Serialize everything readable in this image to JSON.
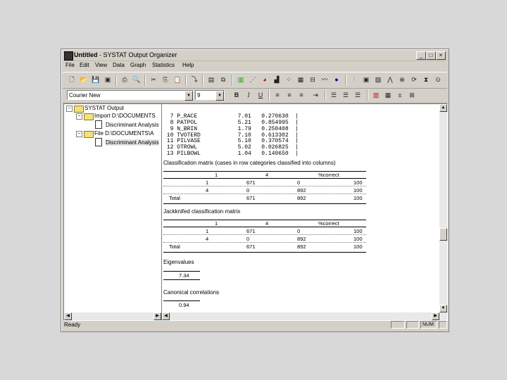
{
  "window": {
    "title_app": "Untitled",
    "title_rest": " - SYSTAT Output Organizer",
    "controls": [
      "_",
      "□",
      "×"
    ]
  },
  "menu": [
    "File",
    "Edit",
    "View",
    "Data",
    "Graph",
    "Statistics",
    "Help"
  ],
  "format_bar": {
    "font": "Courier New",
    "size": "9",
    "bold": "B",
    "italic": "I",
    "underline": "U"
  },
  "tree": {
    "root": "SYSTAT Output",
    "import_node": "Import D:\\DOCUMENTS",
    "import_child": "Discriminant Analysis",
    "file_node": "File D:\\DOCUMENTS\\A",
    "file_child": "Discriminant Analysis"
  },
  "output": {
    "var_rows": [
      {
        "n": "7",
        "name": "P_RACE",
        "f": "7.01",
        "p": "0.270630"
      },
      {
        "n": "8",
        "name": "PATPOL",
        "f": "5.21",
        "p": "0.854995"
      },
      {
        "n": "9",
        "name": "N_BRIN",
        "f": "1.79",
        "p": "0.250408"
      },
      {
        "n": "10",
        "name": "TVOTERD",
        "f": "7.10",
        "p": "0.613302"
      },
      {
        "n": "11",
        "name": "PILVASE",
        "f": "5.10",
        "p": "0.370574"
      },
      {
        "n": "12",
        "name": "OTROWL",
        "f": "5.02",
        "p": "0.026825"
      },
      {
        "n": "13",
        "name": "PILBOWL",
        "f": "1.04",
        "p": "0.140650"
      }
    ],
    "classification_title": "Classification matrix (cases in row categories classified into columns)",
    "jackknifed_title": "Jackknifed classification matrix",
    "matrix_header": [
      "1",
      "4",
      "%correct"
    ],
    "classification_rows": [
      [
        "1",
        "671",
        "0",
        "100"
      ],
      [
        "4",
        "0",
        "892",
        "100"
      ],
      [
        "Total",
        "671",
        "892",
        "100"
      ]
    ],
    "jackknifed_rows": [
      [
        "1",
        "671",
        "0",
        "100"
      ],
      [
        "4",
        "0",
        "892",
        "100"
      ],
      [
        "Total",
        "671",
        "892",
        "100"
      ]
    ],
    "eigen_title": "Eigenvalues",
    "eigen_value": "7.34",
    "canonical_title": "Canonical correlations",
    "canonical_value": "0.94"
  },
  "status": {
    "ready": "Ready",
    "num": "NUM"
  }
}
